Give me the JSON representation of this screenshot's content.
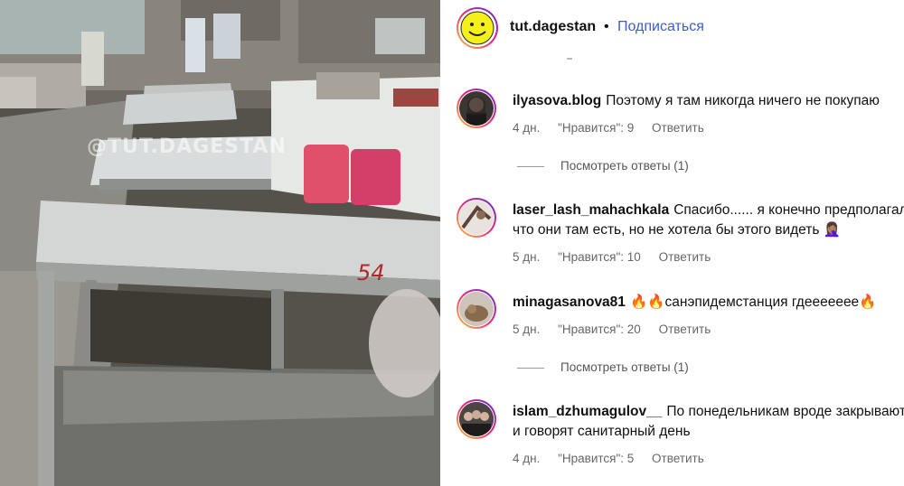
{
  "media": {
    "watermark": "@TUT.DAGESTAN",
    "table_label": "54"
  },
  "header": {
    "username": "tut.dagestan",
    "separator": "•",
    "follow_label": "Подписаться"
  },
  "comments": [
    {
      "username": "ilyasova.blog",
      "text": "Поэтому я там никогда ничего не покупаю",
      "text2": "",
      "time": "4 дн.",
      "likes": "\"Нравится\": 9",
      "reply": "Ответить",
      "view_replies": "Посмотреть ответы (1)"
    },
    {
      "username": "laser_lash_mahachkala",
      "text": "Спасибо...... я конечно предполагала,",
      "text2": "что они там есть, но не хотела бы этого видеть 🤦🏽‍♀️",
      "time": "5 дн.",
      "likes": "\"Нравится\": 10",
      "reply": "Ответить",
      "view_replies": ""
    },
    {
      "username": "minagasanova81",
      "text": "🔥🔥санэпидемстанция гдеееееее🔥",
      "text2": "",
      "time": "5 дн.",
      "likes": "\"Нравится\": 20",
      "reply": "Ответить",
      "view_replies": "Посмотреть ответы (1)"
    },
    {
      "username": "islam_dzhumagulov__",
      "text": "По понедельникам вроде закрывают",
      "text2": "и говорят санитарный день",
      "time": "4 дн.",
      "likes": "\"Нравится\": 5",
      "reply": "Ответить",
      "view_replies": ""
    }
  ]
}
